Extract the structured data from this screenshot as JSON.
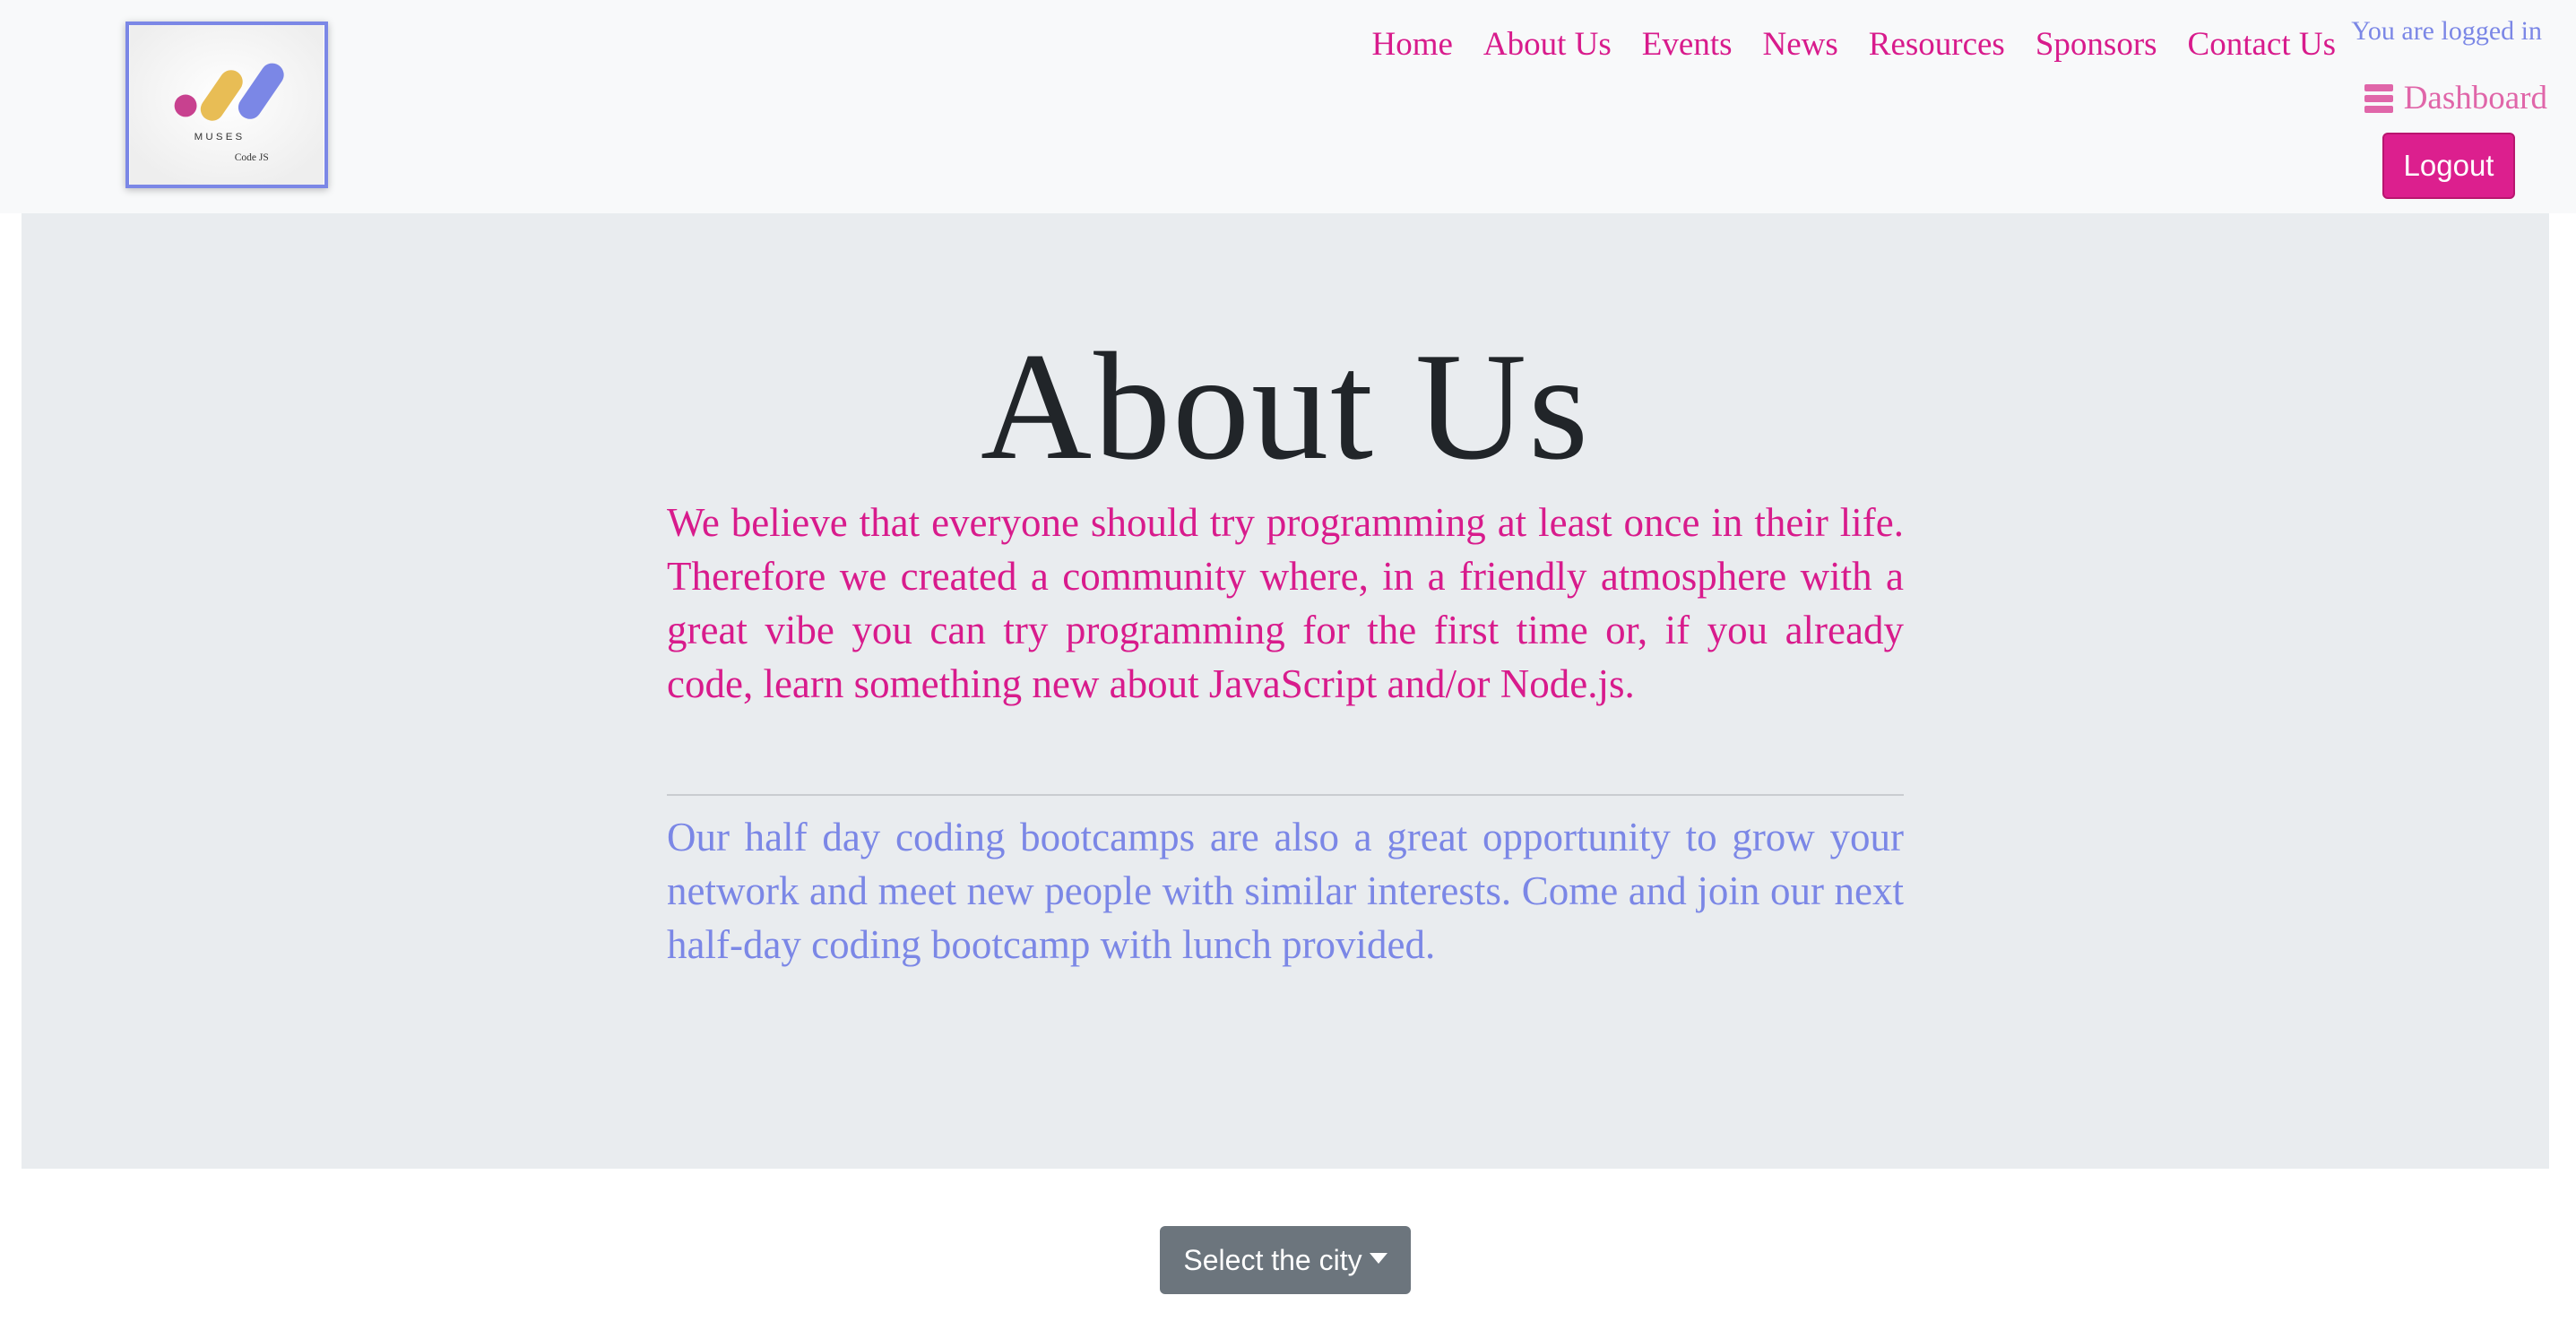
{
  "logo": {
    "wordmark": "M U S E S",
    "sub": "Code JS"
  },
  "nav": {
    "links": [
      {
        "label": "Home"
      },
      {
        "label": "About Us"
      },
      {
        "label": "Events"
      },
      {
        "label": "News"
      },
      {
        "label": "Resources"
      },
      {
        "label": "Sponsors"
      },
      {
        "label": "Contact Us"
      }
    ]
  },
  "user": {
    "status": "You are logged in",
    "dashboard_label": "Dashboard",
    "dashboard_icon": "server-icon",
    "logout_label": "Logout"
  },
  "hero": {
    "title": "About Us",
    "lead": "We believe that everyone should try programming at least once in their life. Therefore we created a community where, in a friendly atmosphere with a great vibe you can try programming for the first time or, if you already code, learn something new about JavaScript and/or Node.js.",
    "secondary": "Our half day coding bootcamps are also a great opportunity to grow your network and meet new people with similar interests. Come and join our next half-day coding bootcamp with lunch provided."
  },
  "city_dropdown": {
    "label": "Select the city"
  },
  "colors": {
    "accent_pink": "#d81b8c",
    "accent_periwinkle": "#7b87e6",
    "logo_yellow": "#e8bd55",
    "navbar_bg": "#f8f9fa",
    "jumbotron_bg": "#e9ecef",
    "dropdown_bg": "#6c757d"
  }
}
